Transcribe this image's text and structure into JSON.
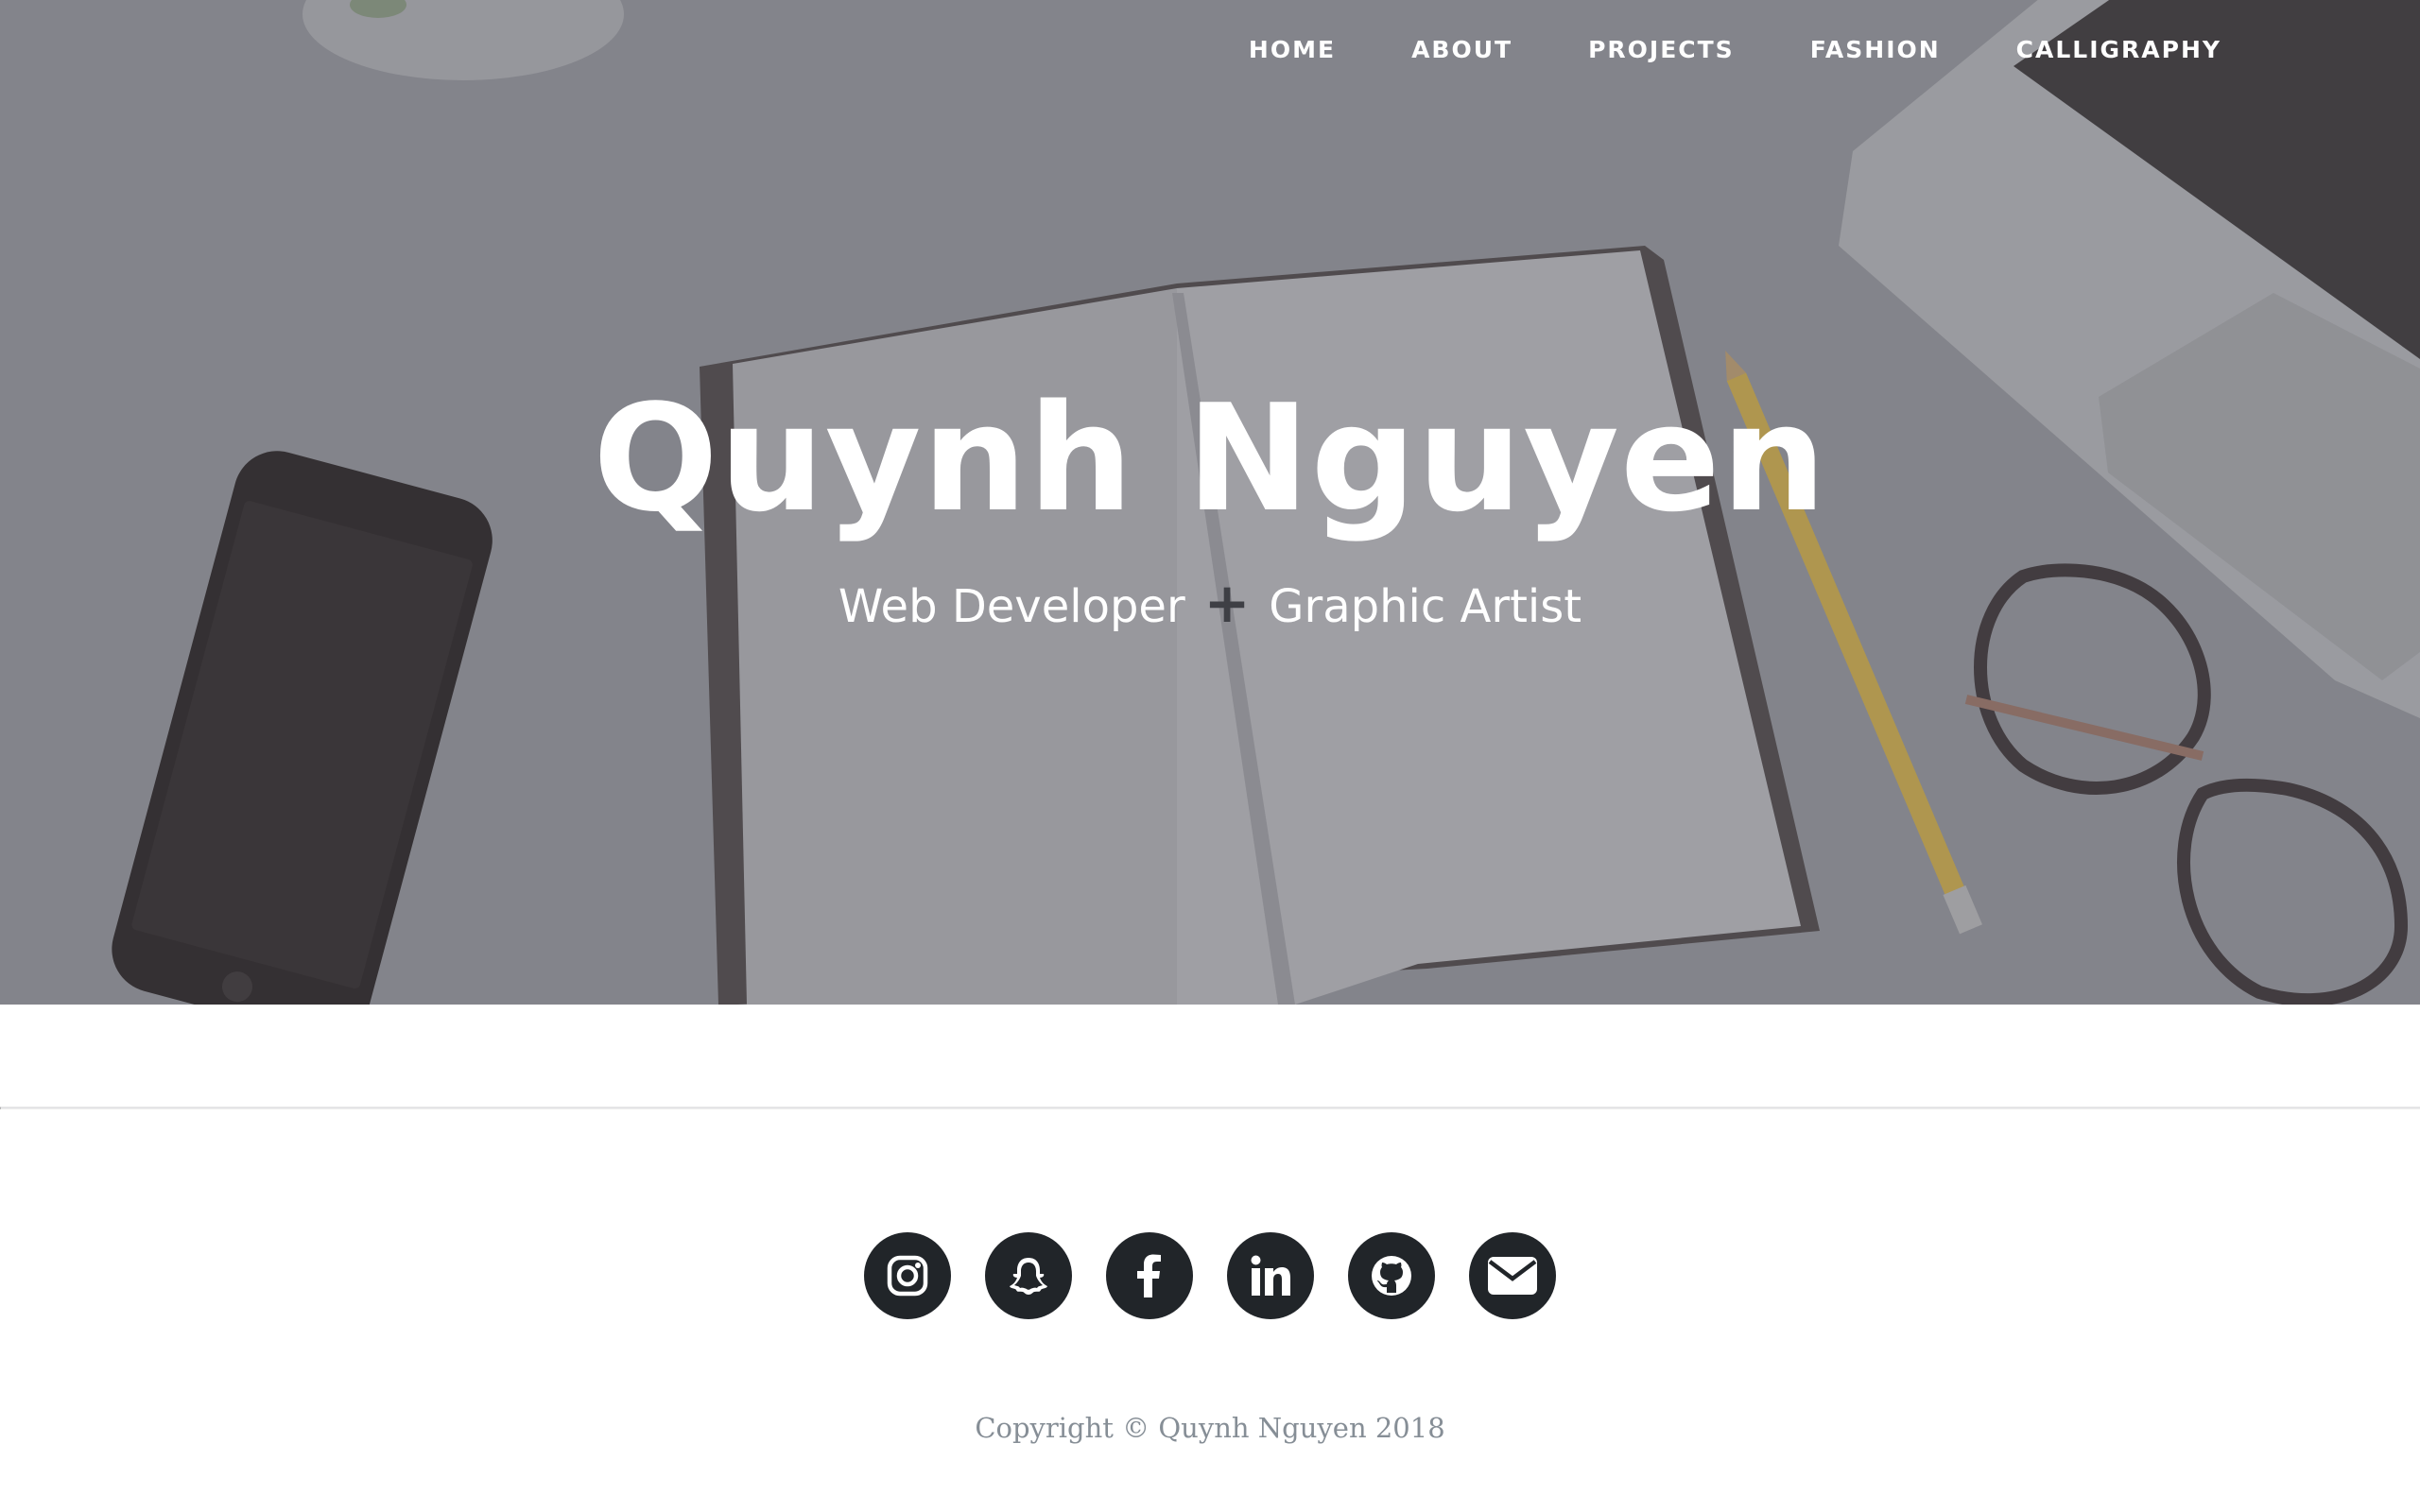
{
  "nav": {
    "items": [
      {
        "label": "HOME"
      },
      {
        "label": "ABOUT"
      },
      {
        "label": "PROJECTS"
      },
      {
        "label": "FASHION"
      },
      {
        "label": "CALLIGRAPHY"
      }
    ]
  },
  "hero": {
    "title": "Quynh Nguyen",
    "subtitle_left": "Web Developer",
    "subtitle_plus": "+",
    "subtitle_right": "Graphic Artist"
  },
  "social": {
    "icons": [
      "instagram-icon",
      "snapchat-icon",
      "facebook-icon",
      "linkedin-icon",
      "github-icon",
      "envelope-icon"
    ]
  },
  "footer": {
    "copyright": "Copyright © Quynh Nguyen 2018"
  },
  "colors": {
    "hero_overlay": "#7f8086",
    "icon_circle": "#212529",
    "copyright_text": "#868e96",
    "divider": "#e4e4e6"
  }
}
